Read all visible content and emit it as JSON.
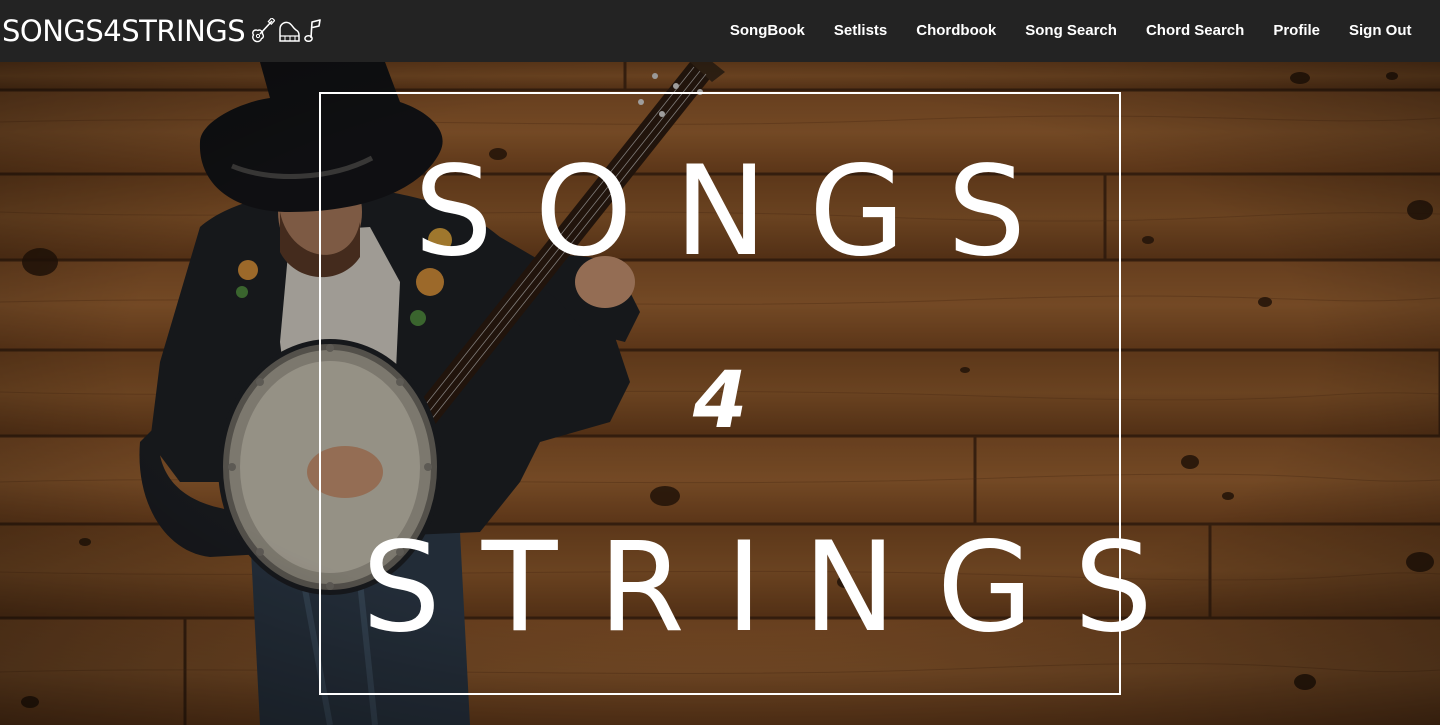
{
  "navbar": {
    "brand": "SONGS4STRINGS",
    "brand_icons": [
      "guitar-icon",
      "piano-icon",
      "music-note-icon"
    ],
    "links": [
      "SongBook",
      "Setlists",
      "Chordbook",
      "Song Search",
      "Chord Search",
      "Profile",
      "Sign Out"
    ]
  },
  "hero": {
    "title_line_1": "SONGS",
    "title_line_2": "4",
    "title_line_3": "STRINGS",
    "background": "photo of a banjo player in a cowboy hat against a wooden plank wall"
  },
  "colors": {
    "navbar_bg": "#232323",
    "text": "#ffffff",
    "wood": "#7a4a22"
  }
}
